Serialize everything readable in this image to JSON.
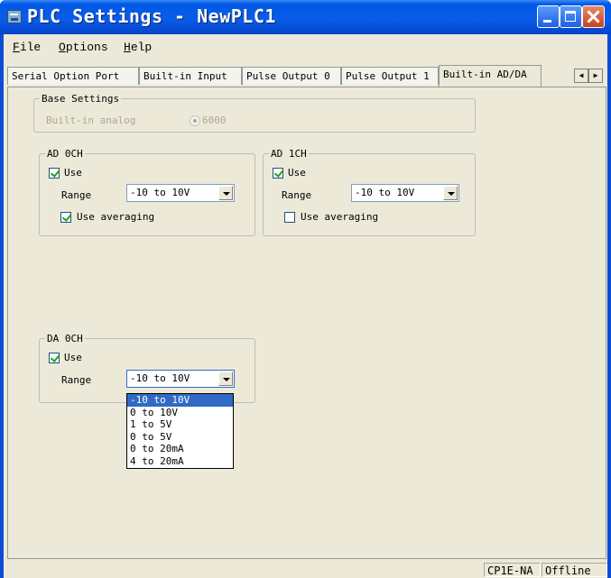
{
  "window": {
    "title": "PLC Settings - NewPLC1"
  },
  "menu": [
    {
      "first": "F",
      "rest": "ile"
    },
    {
      "first": "O",
      "rest": "ptions"
    },
    {
      "first": "H",
      "rest": "elp"
    }
  ],
  "tabs": [
    "Serial Option Port",
    "Built-in Input",
    "Pulse Output 0",
    "Pulse Output 1",
    "Built-in AD/DA"
  ],
  "active_tab": "Built-in AD/DA",
  "base_settings": {
    "legend": "Base Settings",
    "label": "Built-in analog",
    "radio_value": "6000"
  },
  "ad0": {
    "legend": "AD 0CH",
    "use_label": "Use",
    "use_checked": true,
    "range_label": "Range",
    "range_value": "-10 to 10V",
    "avg_label": "Use averaging",
    "avg_checked": true
  },
  "ad1": {
    "legend": "AD 1CH",
    "use_label": "Use",
    "use_checked": true,
    "range_label": "Range",
    "range_value": "-10 to 10V",
    "avg_label": "Use averaging",
    "avg_checked": false
  },
  "da0": {
    "legend": "DA 0CH",
    "use_label": "Use",
    "use_checked": true,
    "range_label": "Range",
    "range_value": "-10 to 10V"
  },
  "range_options": [
    "-10 to 10V",
    "0 to 10V",
    "1 to 5V",
    "0 to 5V",
    "0 to 20mA",
    "4 to 20mA"
  ],
  "range_selected_index": 0,
  "status": {
    "model": "CP1E-NA",
    "state": "Offline"
  },
  "colors": {
    "title_bar": "#0A5DE8",
    "selection": "#316AC5",
    "face": "#ECE9D8"
  }
}
